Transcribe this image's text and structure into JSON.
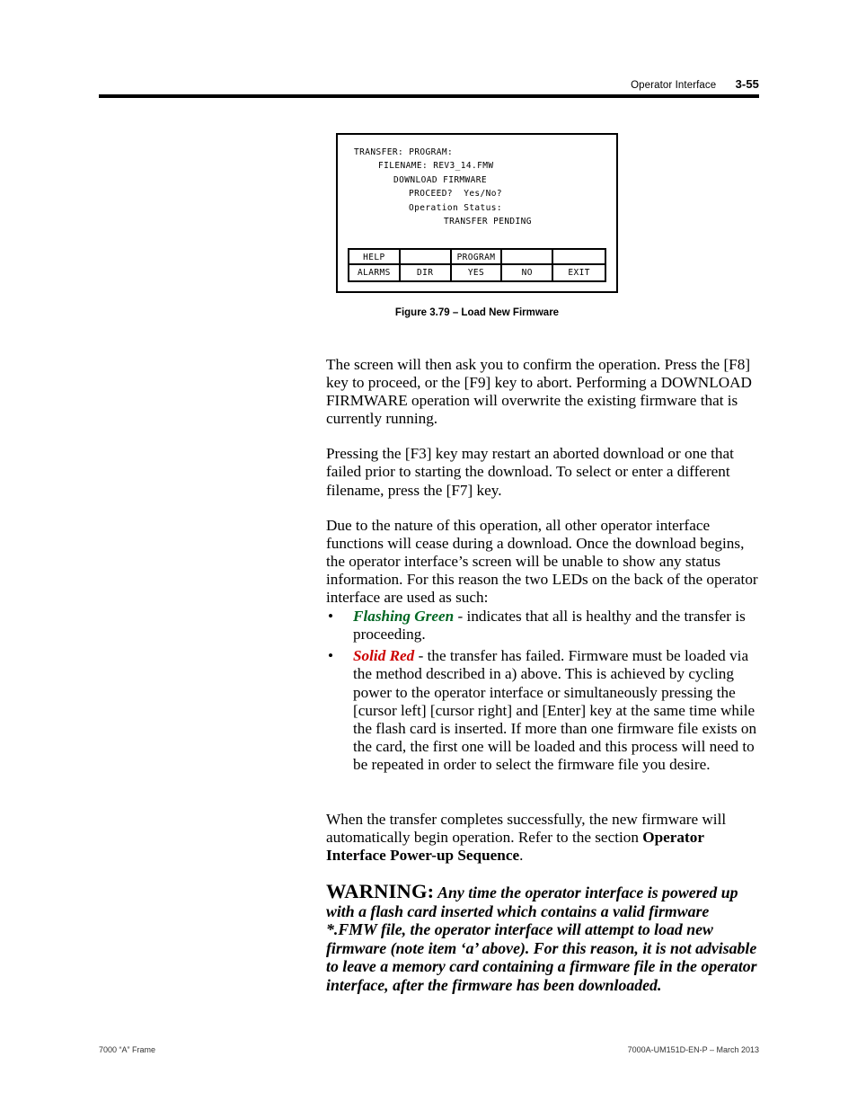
{
  "header": {
    "title": "Operator Interface",
    "page_number": "3-55"
  },
  "figure": {
    "caption": "Figure 3.79 – Load New Firmware",
    "terminal": {
      "lines": [
        "TRANSFER: PROGRAM:",
        "FILENAME: REV3_14.FMW",
        "DOWNLOAD FIRMWARE",
        "PROCEED?  Yes/No?",
        "Operation Status:",
        "TRANSFER PENDING"
      ],
      "softkeys": {
        "row_top": [
          "HELP",
          "",
          "PROGRAM",
          "",
          ""
        ],
        "row_bottom": [
          "ALARMS",
          "DIR",
          "YES",
          "NO",
          "EXIT"
        ]
      }
    }
  },
  "body": {
    "para1": "The screen will then ask you to confirm the operation.  Press the [F8] key to proceed, or the [F9] key to abort.  Performing a DOWNLOAD FIRMWARE operation will overwrite the existing firmware that is currently running.",
    "para2": "Pressing the [F3] key may restart an aborted download or one that failed prior to starting the download.  To select or enter a different filename, press the [F7] key.",
    "para3": "Due to the nature of this operation, all other operator interface functions will cease during a download.  Once the download begins, the operator interface’s screen will be unable to show any status information.  For this reason the two LEDs on the back of the operator interface are used as such:",
    "bullet_glyph": "•",
    "led_items": [
      {
        "label": "Flashing Green",
        "color": "#006622",
        "text": " - indicates that all is healthy and the transfer is proceeding."
      },
      {
        "label": "Solid Red",
        "color": "#cc0000",
        "text": " - the transfer has failed.  Firmware must be loaded via the method described in a) above.  This is achieved by cycling power to the operator interface or simultaneously pressing the [cursor left] [cursor right] and [Enter] key at the same time while the flash card is inserted.  If more than one firmware file exists on the card, the first one will be loaded and this process will need to be repeated in order to select the firmware file you desire."
      }
    ],
    "closing_prefix": "When the transfer completes successfully, the new firmware will automatically begin operation.  Refer to the section ",
    "closing_bold": "Operator Interface Power-up Sequence",
    "closing_suffix": ".",
    "warning_label": "WARNING:",
    "warning_text": " Any time the operator interface is powered up with a flash card inserted which contains a valid firmware *.FMW file, the operator interface will attempt to load new firmware (note item ‘a’ above).  For this reason, it is not advisable to leave a memory card containing a firmware file in the operator interface, after the firmware has been downloaded."
  },
  "footer": {
    "left": "7000 “A” Frame",
    "right": "7000A-UM151D-EN-P – March 2013"
  }
}
